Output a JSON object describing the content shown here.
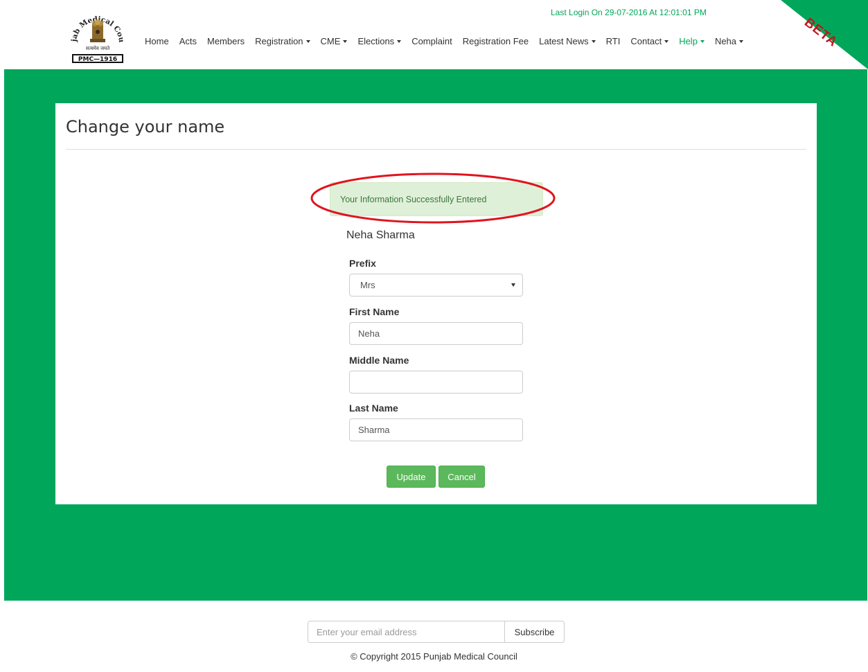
{
  "header": {
    "logo_text": {
      "arc": "Punjab Medical Council",
      "motto": "सत्यमेव जयते",
      "code": "PMC—1916"
    },
    "last_login": "Last Login On 29-07-2016 At 12:01:01 PM",
    "beta": "BETA",
    "nav": [
      {
        "label": "Home",
        "dropdown": false
      },
      {
        "label": "Acts",
        "dropdown": false
      },
      {
        "label": "Members",
        "dropdown": false
      },
      {
        "label": "Registration",
        "dropdown": true
      },
      {
        "label": "CME",
        "dropdown": true
      },
      {
        "label": "Elections",
        "dropdown": true
      },
      {
        "label": "Complaint",
        "dropdown": false
      },
      {
        "label": "Registration Fee",
        "dropdown": false
      },
      {
        "label": "Latest News",
        "dropdown": true
      },
      {
        "label": "RTI",
        "dropdown": false
      },
      {
        "label": "Contact",
        "dropdown": true
      },
      {
        "label": "Help",
        "dropdown": true,
        "active": true
      },
      {
        "label": "Neha",
        "dropdown": true
      }
    ]
  },
  "page": {
    "title": "Change your name",
    "alert": "Your Information Successfully Entered",
    "person_name": "Neha Sharma",
    "form": {
      "prefix_label": "Prefix",
      "prefix_value": "Mrs",
      "first_name_label": "First Name",
      "first_name_value": "Neha",
      "middle_name_label": "Middle Name",
      "middle_name_value": "",
      "last_name_label": "Last Name",
      "last_name_value": "Sharma",
      "update_label": "Update",
      "cancel_label": "Cancel"
    }
  },
  "footer": {
    "email_placeholder": "Enter your email address",
    "subscribe_label": "Subscribe",
    "copyright": "© Copyright 2015 Punjab Medical Council"
  },
  "colors": {
    "brand_green": "#00a65a",
    "button_green": "#5cb85c",
    "alert_bg": "#dff0d8",
    "annotation_red": "#e0141e"
  },
  "icons": {
    "dropdown": "caret-down-icon",
    "logo": "state-emblem-icon"
  }
}
